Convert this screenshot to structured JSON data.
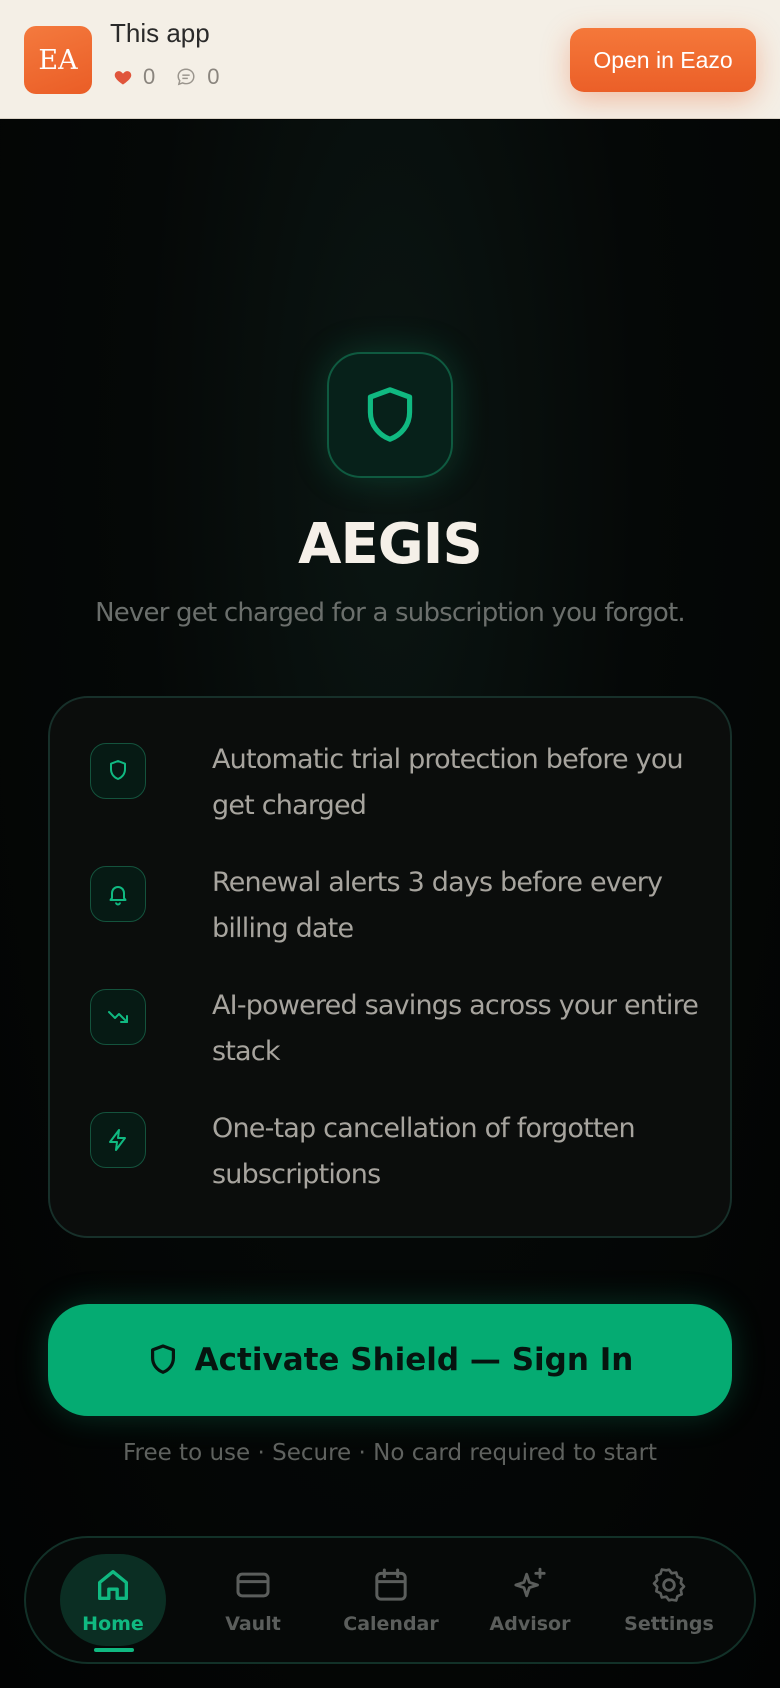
{
  "banner": {
    "app_icon_text": "EA",
    "title": "This app",
    "likes": "0",
    "comments": "0",
    "open_button": "Open in Eazo"
  },
  "hero": {
    "brand": "AEGIS",
    "tagline": "Never get charged for a subscription you forgot."
  },
  "features": [
    {
      "icon": "shield-icon",
      "text": "Automatic trial protection before you get charged"
    },
    {
      "icon": "bell-icon",
      "text": "Renewal alerts 3 days before every billing date"
    },
    {
      "icon": "trending-down-icon",
      "text": "AI-powered savings across your entire stack"
    },
    {
      "icon": "lightning-icon",
      "text": "One-tap cancellation of forgotten subscriptions"
    }
  ],
  "cta": {
    "label": "Activate Shield — Sign In"
  },
  "fineprint": "Free to use · Secure · No card required to start",
  "nav": {
    "items": [
      {
        "label": "Home",
        "icon": "home-icon",
        "active": true
      },
      {
        "label": "Vault",
        "icon": "card-icon",
        "active": false
      },
      {
        "label": "Calendar",
        "icon": "calendar-icon",
        "active": false
      },
      {
        "label": "Advisor",
        "icon": "sparkles-icon",
        "active": false
      },
      {
        "label": "Settings",
        "icon": "gear-icon",
        "active": false
      }
    ]
  },
  "colors": {
    "accent": "#10b981",
    "banner_bg": "#f4efe6",
    "open_button": "#eb5f28",
    "background": "#030504"
  }
}
